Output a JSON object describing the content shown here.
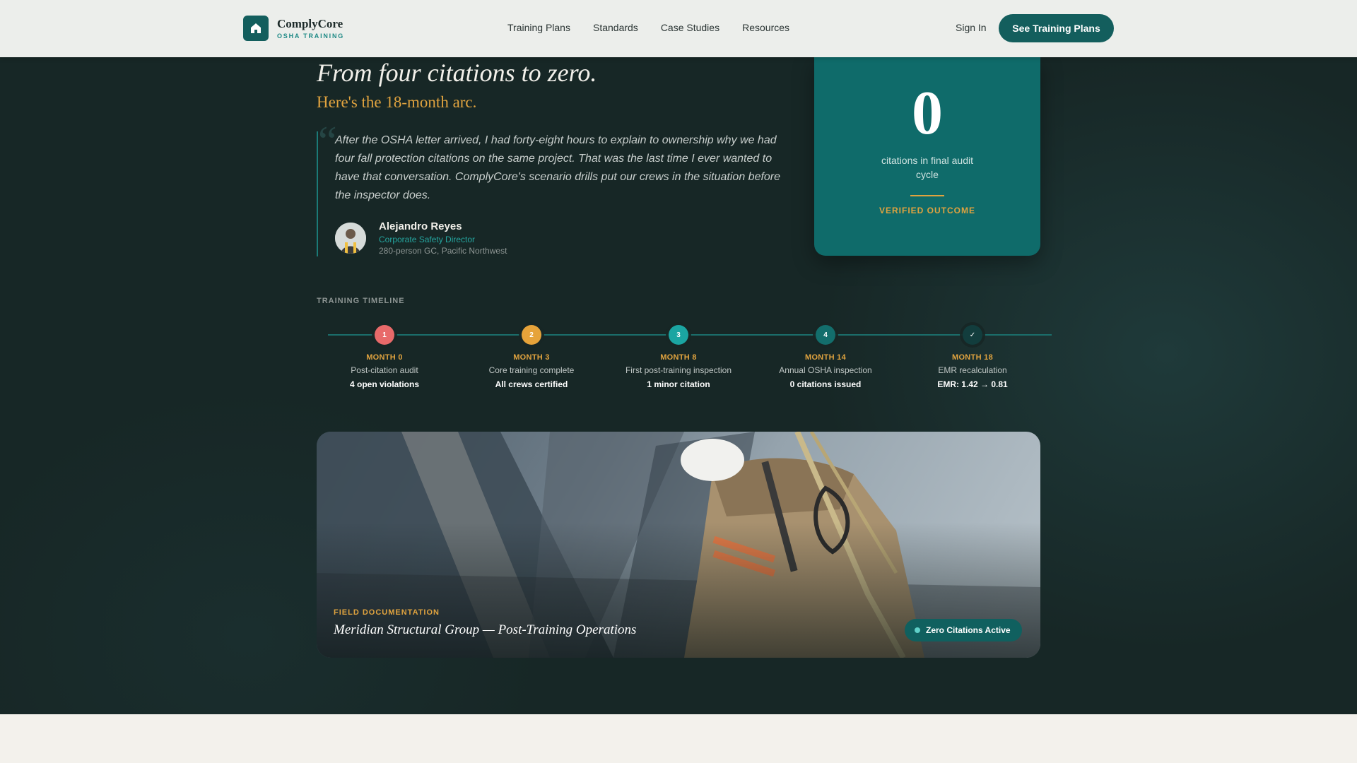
{
  "header": {
    "brand_name": "ComplyCore",
    "brand_sub": "OSHA TRAINING",
    "nav": [
      {
        "label": "Training Plans"
      },
      {
        "label": "Standards"
      },
      {
        "label": "Case Studies"
      },
      {
        "label": "Resources"
      }
    ],
    "signin": "Sign In",
    "cta": "See Training Plans"
  },
  "hero": {
    "title": "From four citations to zero.",
    "subtitle": "Here's the 18-month arc.",
    "quote": "After the OSHA letter arrived, I had forty-eight hours to explain to ownership why we had four fall protection citations on the same project. That was the last time I ever wanted to have that conversation. ComplyCore's scenario drills put our crews in the situation before the inspector does.",
    "author": {
      "name": "Alejandro Reyes",
      "role": "Corporate Safety Director",
      "org": "280-person GC, Pacific Northwest"
    }
  },
  "stat": {
    "value": "0",
    "label": "citations in final audit cycle",
    "verified": "VERIFIED OUTCOME"
  },
  "timeline": {
    "label": "TRAINING TIMELINE",
    "steps": [
      {
        "marker": "1",
        "color": "#e86a6a",
        "month": "MONTH 0",
        "desc": "Post-citation audit",
        "result": "4 open violations"
      },
      {
        "marker": "2",
        "color": "#e6a33a",
        "month": "MONTH 3",
        "desc": "Core training complete",
        "result": "All crews certified"
      },
      {
        "marker": "3",
        "color": "#1ba5a2",
        "month": "MONTH 8",
        "desc": "First post-training inspection",
        "result": "1 minor citation"
      },
      {
        "marker": "4",
        "color": "#136e6c",
        "month": "MONTH 14",
        "desc": "Annual OSHA inspection",
        "result": "0 citations issued"
      },
      {
        "marker": "✓",
        "color": "#123d3d",
        "month": "MONTH 18",
        "desc": "EMR recalculation",
        "result": "EMR: 1.42 → 0.81"
      }
    ]
  },
  "photo": {
    "kicker": "FIELD DOCUMENTATION",
    "caption": "Meridian Structural Group — Post-Training Operations",
    "badge": "Zero Citations Active"
  }
}
